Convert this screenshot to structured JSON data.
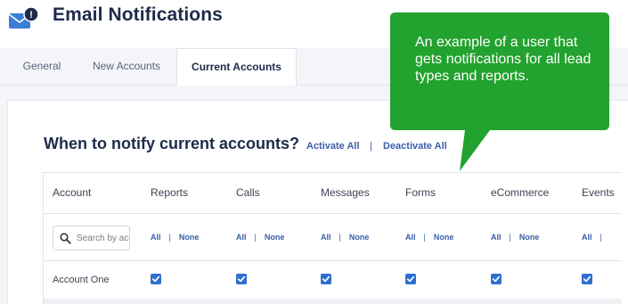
{
  "header": {
    "title": "Email Notifications",
    "icon": "mail-alert-icon",
    "badge": "!"
  },
  "tabs": [
    {
      "label": "General",
      "active": false
    },
    {
      "label": "New Accounts",
      "active": false
    },
    {
      "label": "Current Accounts",
      "active": true
    }
  ],
  "section": {
    "title": "When to notify current accounts?",
    "activate_all": "Activate All",
    "separator": "|",
    "deactivate_all": "Deactivate All"
  },
  "table": {
    "columns": [
      "Account",
      "Reports",
      "Calls",
      "Messages",
      "Forms",
      "eCommerce",
      "Events"
    ],
    "search_placeholder": "Search by account",
    "toggle_all": "All",
    "toggle_sep": "|",
    "toggle_none": "None",
    "rows": [
      {
        "account": "Account One",
        "checked": [
          true,
          true,
          true,
          true,
          true,
          true
        ]
      }
    ]
  },
  "callout": {
    "text": "An example of a user that gets notifications for all lead types and reports.",
    "color": "#22a22e"
  },
  "colors": {
    "brand_dark": "#1e2a4a",
    "link": "#3a5fa8",
    "checkbox": "#2f6fd1",
    "icon_blue": "#3b7fd4"
  }
}
